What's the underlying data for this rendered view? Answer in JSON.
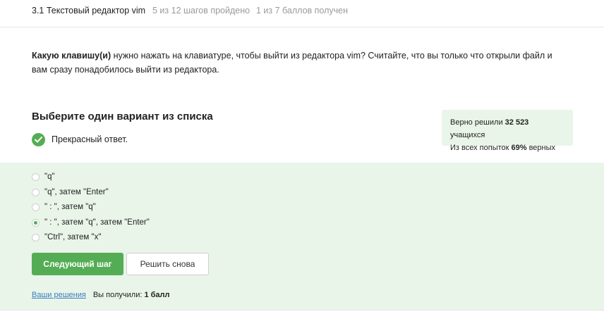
{
  "header": {
    "title": "3.1 Текстовый редактор vim",
    "progress": "5 из 12 шагов пройдено",
    "score": "1 из 7 баллов  получен"
  },
  "question": {
    "bold_part": "Какую клавишу(и)",
    "rest": " нужно нажать на клавиатуре, чтобы выйти из редактора vim? Считайте, что вы только что открыли файл и вам сразу понадобилось выйти из редактора."
  },
  "choose_title": "Выберите один вариант из списка",
  "feedback": {
    "icon": "check-circle-icon",
    "text": "Прекрасный ответ."
  },
  "stats": {
    "solved_prefix": "Верно решили ",
    "solved_count": "32 523",
    "solved_suffix": " учащихся",
    "attempts_prefix": "Из всех попыток ",
    "attempts_percent": "69%",
    "attempts_suffix": " верных"
  },
  "options": [
    {
      "label": "\"q\"",
      "checked": false
    },
    {
      "label": "\"q\", затем \"Enter\"",
      "checked": false
    },
    {
      "label": "\" : \", затем \"q\"",
      "checked": false
    },
    {
      "label": "\" : \", затем \"q\", затем \"Enter\"",
      "checked": true
    },
    {
      "label": "\"Ctrl\", затем \"x\"",
      "checked": false
    }
  ],
  "buttons": {
    "next": "Следующий шаг",
    "retry": "Решить снова"
  },
  "footer": {
    "solutions_link": "Ваши решения",
    "got_prefix": "Вы получили: ",
    "got_value": "1 балл"
  },
  "colors": {
    "accent": "#54ad54",
    "panel_bg": "#e9f5e9",
    "link": "#3b7dbf"
  }
}
